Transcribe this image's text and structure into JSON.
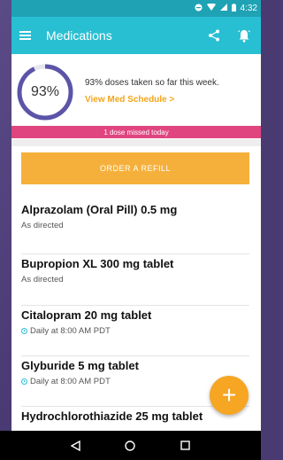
{
  "status_bar": {
    "time": "4:32"
  },
  "app_bar": {
    "title": "Medications",
    "menu_icon": "menu-icon",
    "share_icon": "share-icon",
    "bell_icon": "bell-icon"
  },
  "adherence": {
    "percent_label": "93%",
    "percent_value": 0.93,
    "summary": "93% doses taken so far this week.",
    "schedule_link": "View Med Schedule >",
    "missed_banner": "1 dose missed today"
  },
  "refill_button": "ORDER A REFILL",
  "medications": [
    {
      "name": "Alprazolam (Oral Pill) 0.5 mg",
      "detail": "As directed",
      "reminder": false
    },
    {
      "name": "Bupropion XL 300 mg tablet",
      "detail": "As directed",
      "reminder": false
    },
    {
      "name": "Citalopram 20 mg tablet",
      "detail": "Daily at 8:00 AM PDT",
      "reminder": true
    },
    {
      "name": "Glyburide 5 mg tablet",
      "detail": "Daily at 8:00 AM PDT",
      "reminder": true
    },
    {
      "name": "Hydrochlorothiazide 25 mg tablet",
      "detail": "",
      "reminder": false
    }
  ],
  "fab_label": "+",
  "colors": {
    "primary": "#28bfd3",
    "accent": "#f6a623",
    "alert": "#e0457f",
    "ring": "#5b54a8"
  }
}
